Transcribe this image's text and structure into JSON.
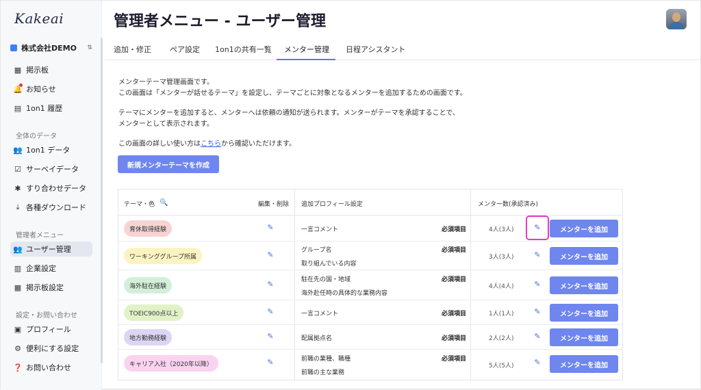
{
  "sidebar": {
    "logo": "Kakeai",
    "company": "株式会社DEMO",
    "items_top": [
      {
        "label": "掲示板",
        "icon": "board-icon"
      },
      {
        "label": "お知らせ",
        "icon": "bell-icon"
      },
      {
        "label": "1on1 履歴",
        "icon": "history-icon"
      }
    ],
    "section_data": "全体のデータ",
    "items_data": [
      {
        "label": "1on1 データ",
        "icon": "people-icon"
      },
      {
        "label": "サーベイデータ",
        "icon": "survey-icon"
      },
      {
        "label": "すり合わせデータ",
        "icon": "puzzle-icon"
      },
      {
        "label": "各種ダウンロード",
        "icon": "download-icon"
      }
    ],
    "section_admin": "管理者メニュー",
    "items_admin": [
      {
        "label": "ユーザー管理",
        "icon": "users-icon"
      },
      {
        "label": "企業設定",
        "icon": "building-icon"
      },
      {
        "label": "掲示板設定",
        "icon": "board-settings-icon"
      }
    ],
    "section_settings": "設定・お問い合わせ",
    "items_settings": [
      {
        "label": "プロフィール",
        "icon": "profile-icon"
      },
      {
        "label": "便利にする設定",
        "icon": "gear-icon"
      },
      {
        "label": "お問い合わせ",
        "icon": "help-icon"
      }
    ]
  },
  "header": {
    "title": "管理者メニュー - ユーザー管理"
  },
  "tabs": [
    "追加・修正",
    "ペア設定",
    "1on1の共有一覧",
    "メンター管理",
    "日程アシスタント"
  ],
  "intro": {
    "line1": "メンターテーマ管理画面です。",
    "line2": "この画面は「メンターが話せるテーマ」を設定し、テーマごとに対象となるメンターを追加するための画面です。",
    "line3": "テーマにメンターを追加すると、メンターへは依頼の通知が送られます。メンターがテーマを承認することで、",
    "line4": "メンターとして表示されます。",
    "line5_pre": "この画面の詳しい使い方は",
    "line5_link": "こちら",
    "line5_post": "から確認いただけます。",
    "create_button": "新規メンターテーマを作成"
  },
  "table": {
    "headers": {
      "theme": "テーマ・色",
      "edit": "編集・削除",
      "profile": "追加プロフィール設定",
      "count": "メンター数(承認済み)"
    },
    "rows": [
      {
        "theme": "育休取得経験",
        "color": "#f7d4d4",
        "profile": [
          "一言コメント"
        ],
        "required": "必須項目",
        "count": "4人(3人)",
        "add": "メンターを追加"
      },
      {
        "theme": "ワーキンググループ所属",
        "color": "#fbf4c2",
        "profile": [
          "グループ名",
          "取り組んでいる内容"
        ],
        "required": "必須項目",
        "count": "3人(3人)",
        "add": "メンターを追加"
      },
      {
        "theme": "海外駐在経験",
        "color": "#d3efd9",
        "profile": [
          "駐在先の国・地域",
          "海外赴任時の具体的な業務内容"
        ],
        "required": "必須項目",
        "count": "4人(4人)",
        "add": "メンターを追加"
      },
      {
        "theme": "TOEIC900点以上",
        "color": "#e2f2c8",
        "profile": [
          "一言コメント"
        ],
        "required": "必須項目",
        "count": "1人(1人)",
        "add": "メンターを追加"
      },
      {
        "theme": "地方勤務経験",
        "color": "#dcd6f4",
        "profile": [
          "配属拠点名"
        ],
        "required": "必須項目",
        "count": "2人(2人)",
        "add": "メンターを追加"
      },
      {
        "theme": "キャリア入社（2020年以降）",
        "color": "#f9d3ef",
        "profile": [
          "前職の業種、職種",
          "前職の主な業務"
        ],
        "required": "必須項目",
        "count": "5人(5人)",
        "add": "メンターを追加"
      }
    ]
  }
}
